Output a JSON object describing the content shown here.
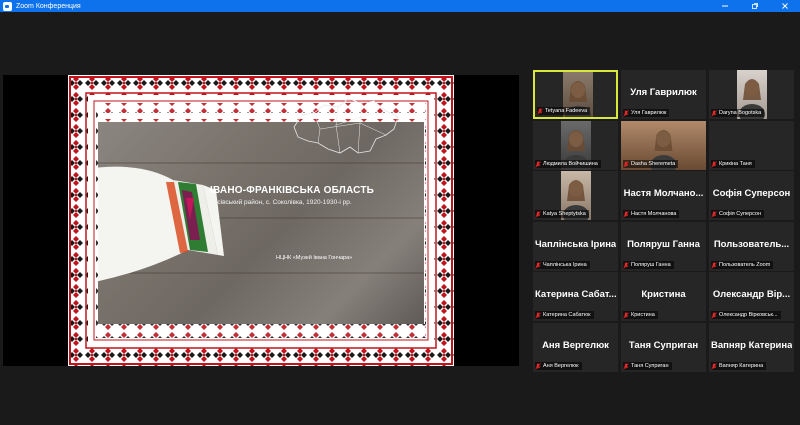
{
  "window": {
    "title": "Zoom Конференция"
  },
  "slide": {
    "title": "ІВАНО-ФРАНКІВСЬКА ОБЛАСТЬ",
    "subtitle": "Косівський район, с. Соколівка, 1920-1930-і рр.",
    "credit": "НЦНК «Музей Івана Гончара»"
  },
  "colors": {
    "titlebar": "#0e72ed",
    "active_speaker": "#d8e83a",
    "tile_bg": "#262626",
    "mic_muted": "#e02828",
    "ornament_red": "#c0141c",
    "ornament_dark": "#1a1a1a"
  },
  "participants": [
    {
      "label": "Tetyana Fadeeva",
      "center_name": "",
      "video": true,
      "active": true
    },
    {
      "label": "Уля Гаврилюк",
      "center_name": "Уля Гаврилюк",
      "video": false,
      "active": false
    },
    {
      "label": "Daryna Bogotska",
      "center_name": "",
      "video": true,
      "active": false
    },
    {
      "label": "Людмила Войчишина",
      "center_name": "",
      "video": true,
      "active": false
    },
    {
      "label": "Dasha Sheremeta",
      "center_name": "",
      "video": true,
      "active": false
    },
    {
      "label": "Крикіна Таня",
      "center_name": "",
      "video": false,
      "active": false
    },
    {
      "label": "Katya Sheptytska",
      "center_name": "",
      "video": true,
      "active": false
    },
    {
      "label": "Настя Молчанова",
      "center_name": "Настя Молчано...",
      "video": false,
      "active": false
    },
    {
      "label": "Софія Суперсон",
      "center_name": "Софія Суперсон",
      "video": false,
      "active": false
    },
    {
      "label": "Чаплінська Ірина",
      "center_name": "Чаплінська Ірина",
      "video": false,
      "active": false
    },
    {
      "label": "Поляруш Ганна",
      "center_name": "Поляруш Ганна",
      "video": false,
      "active": false
    },
    {
      "label": "Пользователь Zoom",
      "center_name": "Пользователь...",
      "video": false,
      "active": false
    },
    {
      "label": "Катерина Сабатюк",
      "center_name": "Катерина Сабат...",
      "video": false,
      "active": false
    },
    {
      "label": "Кристина",
      "center_name": "Кристина",
      "video": false,
      "active": false
    },
    {
      "label": "Олександр Вірковськ...",
      "center_name": "Олександр Вір...",
      "video": false,
      "active": false
    },
    {
      "label": "Аня Вергелюк",
      "center_name": "Аня Вергелюк",
      "video": false,
      "active": false
    },
    {
      "label": "Таня Суприган",
      "center_name": "Таня Суприган",
      "video": false,
      "active": false
    },
    {
      "label": "Вапняр Катерина",
      "center_name": "Вапняр Катерина",
      "video": false,
      "active": false
    }
  ]
}
